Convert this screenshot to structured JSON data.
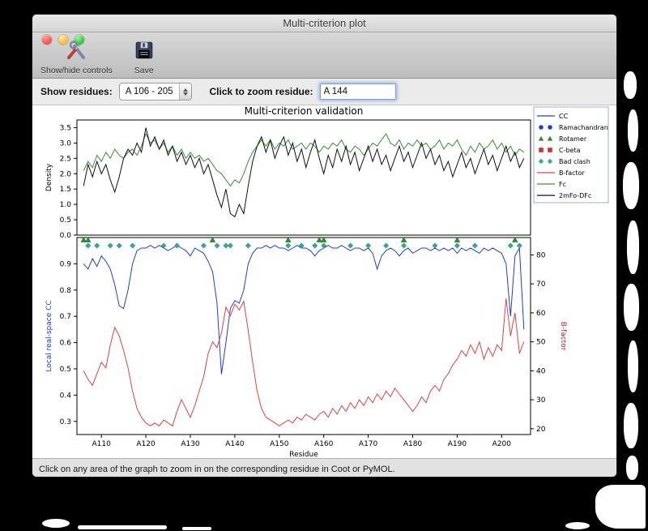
{
  "window_title": "Multi-criterion plot",
  "toolbar": {
    "show_hide_label": "Show/hide controls",
    "save_label": "Save"
  },
  "controls": {
    "show_residues_label": "Show residues:",
    "residue_range_value": "A 106 - 205",
    "zoom_label": "Click to zoom residue:",
    "zoom_value": "A 144"
  },
  "status_text": "Click on any area of the graph to zoom in on the corresponding residue in Coot or PyMOL.",
  "chart_data": {
    "type": "line",
    "title": "Multi-criterion validation",
    "xlabel": "Residue",
    "x_start": 106,
    "xlim": [
      104.5,
      206.5
    ],
    "x_ticks": [
      "A110",
      "A120",
      "A130",
      "A140",
      "A150",
      "A160",
      "A170",
      "A180",
      "A190",
      "A200"
    ],
    "x_tick_values": [
      110,
      120,
      130,
      140,
      150,
      160,
      170,
      180,
      190,
      200
    ],
    "top_plot": {
      "ylabel": "Density",
      "ylim": [
        0.0,
        3.75
      ],
      "yticks": [
        0.0,
        0.5,
        1.0,
        1.5,
        2.0,
        2.5,
        3.0,
        3.5
      ],
      "series": [
        {
          "name": "Fc",
          "color": "#3a8f3a",
          "values": [
            2.1,
            2.4,
            2.2,
            2.6,
            2.4,
            2.7,
            2.5,
            2.8,
            2.6,
            2.5,
            2.7,
            2.8,
            2.6,
            2.9,
            3.3,
            3.0,
            3.1,
            2.8,
            3.0,
            2.7,
            2.9,
            2.6,
            2.8,
            2.5,
            2.7,
            2.5,
            2.6,
            2.4,
            2.5,
            2.3,
            2.1,
            2.0,
            1.8,
            1.6,
            1.8,
            1.7,
            2.0,
            2.4,
            2.7,
            2.9,
            3.1,
            2.9,
            3.1,
            2.8,
            3.0,
            2.9,
            3.1,
            2.8,
            2.9,
            3.0,
            2.8,
            3.0,
            2.9,
            2.7,
            2.9,
            2.8,
            3.0,
            2.9,
            3.1,
            2.8,
            2.7,
            2.9,
            2.8,
            2.6,
            2.8,
            3.0,
            2.9,
            3.1,
            3.3,
            3.0,
            2.9,
            3.1,
            2.8,
            3.0,
            2.9,
            3.1,
            2.9,
            3.0,
            2.8,
            2.9,
            3.1,
            2.8,
            3.0,
            2.9,
            3.1,
            2.8,
            2.6,
            2.9,
            2.7,
            3.0,
            2.8,
            2.9,
            3.1,
            2.8,
            3.0,
            2.7,
            2.9,
            2.6,
            2.8,
            2.7
          ]
        },
        {
          "name": "2mFo-DFc",
          "color": "#101010",
          "values": [
            1.6,
            2.3,
            1.9,
            2.4,
            2.0,
            2.3,
            1.8,
            1.4,
            1.9,
            2.5,
            2.8,
            2.6,
            3.0,
            2.7,
            3.5,
            2.9,
            3.2,
            2.8,
            3.1,
            2.6,
            2.9,
            2.4,
            2.7,
            2.3,
            2.6,
            2.2,
            2.5,
            2.0,
            2.3,
            1.8,
            1.3,
            0.9,
            1.5,
            0.7,
            0.6,
            1.0,
            0.7,
            1.6,
            2.4,
            2.9,
            3.2,
            2.7,
            3.1,
            2.5,
            2.9,
            3.2,
            2.6,
            3.0,
            2.4,
            2.8,
            2.2,
            2.7,
            3.1,
            2.5,
            2.0,
            2.6,
            2.2,
            2.8,
            2.4,
            2.9,
            2.3,
            2.7,
            2.1,
            2.5,
            2.9,
            2.4,
            2.8,
            2.3,
            2.6,
            2.1,
            2.5,
            2.9,
            2.4,
            2.7,
            2.2,
            2.6,
            3.0,
            2.5,
            2.8,
            2.3,
            2.6,
            2.1,
            2.4,
            1.9,
            2.3,
            2.7,
            2.2,
            2.5,
            2.0,
            2.4,
            2.8,
            2.3,
            2.6,
            2.1,
            2.5,
            2.9,
            2.4,
            2.7,
            2.2,
            2.5
          ]
        }
      ]
    },
    "bottom_plot": {
      "left_ylabel": "Local real-space CC",
      "left_color": "#2040cc",
      "left_ylim": [
        0.25,
        1.0
      ],
      "left_yticks": [
        0.3,
        0.4,
        0.5,
        0.6,
        0.7,
        0.8,
        0.9
      ],
      "right_ylabel": "B-factor",
      "right_color": "#cc2222",
      "right_ylim": [
        18,
        86
      ],
      "right_yticks": [
        20,
        30,
        40,
        50,
        60,
        70,
        80
      ],
      "series": [
        {
          "name": "CC",
          "axis": "left",
          "color": "#2040cc",
          "values": [
            0.9,
            0.88,
            0.92,
            0.89,
            0.93,
            0.91,
            0.88,
            0.82,
            0.74,
            0.73,
            0.8,
            0.9,
            0.95,
            0.96,
            0.96,
            0.97,
            0.96,
            0.97,
            0.96,
            0.95,
            0.96,
            0.97,
            0.96,
            0.95,
            0.93,
            0.96,
            0.95,
            0.94,
            0.91,
            0.87,
            0.75,
            0.48,
            0.6,
            0.73,
            0.76,
            0.75,
            0.8,
            0.9,
            0.94,
            0.96,
            0.96,
            0.97,
            0.96,
            0.97,
            0.96,
            0.96,
            0.95,
            0.96,
            0.97,
            0.96,
            0.96,
            0.95,
            0.93,
            0.95,
            0.96,
            0.97,
            0.96,
            0.96,
            0.97,
            0.96,
            0.95,
            0.96,
            0.96,
            0.95,
            0.96,
            0.94,
            0.88,
            0.93,
            0.95,
            0.96,
            0.95,
            0.93,
            0.95,
            0.96,
            0.94,
            0.95,
            0.96,
            0.96,
            0.95,
            0.96,
            0.95,
            0.96,
            0.95,
            0.96,
            0.94,
            0.96,
            0.95,
            0.96,
            0.95,
            0.94,
            0.96,
            0.95,
            0.96,
            0.95,
            0.94,
            0.9,
            0.7,
            0.93,
            0.96,
            0.65
          ]
        },
        {
          "name": "B-factor",
          "axis": "right",
          "color": "#dd4444",
          "values": [
            40,
            37,
            35,
            39,
            43,
            41,
            49,
            55,
            52,
            47,
            41,
            33,
            27,
            24,
            22,
            21,
            22,
            21,
            23,
            22,
            21,
            26,
            30,
            27,
            24,
            28,
            33,
            38,
            46,
            50,
            48,
            53,
            62,
            59,
            63,
            61,
            64,
            54,
            43,
            33,
            27,
            24,
            23,
            22,
            21,
            22,
            23,
            22,
            24,
            23,
            25,
            24,
            23,
            25,
            26,
            24,
            27,
            25,
            28,
            26,
            29,
            27,
            30,
            28,
            31,
            29,
            32,
            30,
            33,
            31,
            34,
            32,
            30,
            28,
            26,
            28,
            31,
            29,
            33,
            35,
            33,
            37,
            39,
            42,
            44,
            47,
            45,
            49,
            46,
            50,
            44,
            48,
            45,
            49,
            47,
            65,
            52,
            60,
            46,
            50
          ]
        }
      ],
      "markers": [
        {
          "name": "Rotamer",
          "shape": "triangle",
          "color": "#2e8b2e",
          "residues": [
            106,
            107,
            135,
            152,
            159,
            160,
            178,
            190,
            203
          ]
        },
        {
          "name": "Bad clash",
          "shape": "diamond",
          "color": "#35a79c",
          "residues": [
            107,
            109,
            112,
            114,
            117,
            124,
            127,
            133,
            136,
            138,
            139,
            143,
            152,
            155,
            158,
            160,
            166,
            170,
            174,
            178,
            185,
            190,
            194,
            202,
            204
          ]
        }
      ]
    },
    "legend": [
      {
        "label": "CC",
        "type": "line",
        "color": "#2040cc"
      },
      {
        "label": "Ramachandran",
        "type": "circles",
        "color": "#2040cc"
      },
      {
        "label": "Rotamer",
        "type": "triangles",
        "color": "#2e8b2e"
      },
      {
        "label": "C-beta",
        "type": "squares",
        "color": "#cc3333"
      },
      {
        "label": "Bad clash",
        "type": "diamonds",
        "color": "#35a79c"
      },
      {
        "label": "B-factor",
        "type": "line",
        "color": "#dd4444"
      },
      {
        "label": "Fc",
        "type": "line",
        "color": "#3a8f3a"
      },
      {
        "label": "2mFo-DFc",
        "type": "line",
        "color": "#101010"
      }
    ]
  }
}
